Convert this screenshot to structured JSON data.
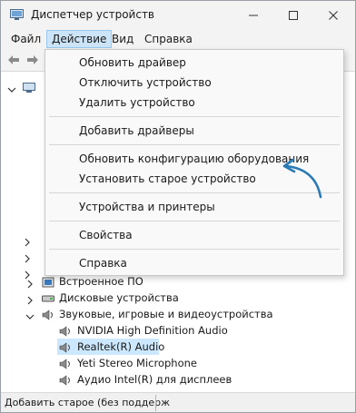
{
  "window": {
    "title": "Диспетчер устройств",
    "accent": "#2a7ab5"
  },
  "menubar": {
    "file": "Файл",
    "action": "Действие",
    "view": "Вид",
    "help": "Справка"
  },
  "action_menu": {
    "items": [
      "Обновить драйвер",
      "Отключить устройство",
      "Удалить устройство",
      "Добавить драйверы",
      "Обновить конфигурацию оборудования",
      "Установить старое устройство",
      "Устройства и принтеры",
      "Свойства",
      "Справка"
    ]
  },
  "tree": {
    "firmware": "Встроенное ПО",
    "disks": "Дисковые устройства",
    "sound": "Звуковые, игровые и видеоустройства",
    "sound_children": [
      "NVIDIA High Definition Audio",
      "Realtek(R) Audio",
      "Yeti Stereo Microphone",
      "Аудио Intel(R) для дисплеев"
    ]
  },
  "statusbar": {
    "text": "Добавить старое (без поддерж"
  }
}
